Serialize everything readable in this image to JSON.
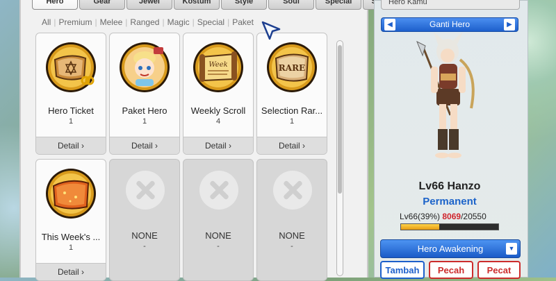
{
  "tabs": [
    "Hero",
    "Gear",
    "Jewel",
    "Kostum",
    "Style",
    "Soul",
    "Special",
    "Storage"
  ],
  "active_tab": "Hero",
  "filters": [
    "All",
    "Premium",
    "Melee",
    "Ranged",
    "Magic",
    "Special",
    "Paket"
  ],
  "items": [
    {
      "name": "Hero Ticket",
      "qty": "1",
      "detail": "Detail",
      "icon": "hero-ticket-scroll-icon"
    },
    {
      "name": "Paket Hero",
      "qty": "1",
      "detail": "Detail",
      "icon": "paket-hero-icon"
    },
    {
      "name": "Weekly Scroll",
      "qty": "4",
      "detail": "Detail",
      "icon": "weekly-scroll-icon"
    },
    {
      "name": "Selection Rar...",
      "qty": "1",
      "detail": "Detail",
      "icon": "rare-scroll-icon"
    },
    {
      "name": "This Week's ...",
      "qty": "1",
      "detail": "Detail",
      "icon": "this-week-scroll-icon"
    },
    {
      "name": "NONE",
      "qty": "-"
    },
    {
      "name": "NONE",
      "qty": "-"
    },
    {
      "name": "NONE",
      "qty": "-"
    }
  ],
  "right_panel": {
    "title": "Hero Kamu",
    "ganti_hero": "Ganti Hero",
    "hero_name": "Lv66 Hanzo",
    "status": "Permanent",
    "exp_prefix": "Lv66(39%)",
    "exp_current": "8069",
    "exp_total": "/20550",
    "exp_progress": 0.39,
    "awakening": "Hero Awakening",
    "buttons": [
      "Tambah",
      "Pecah",
      "Pecat"
    ]
  },
  "colors": {
    "accent_blue": "#1c5fcb",
    "accent_red": "#cc2b2b",
    "exp_fill": "#f0b124"
  }
}
